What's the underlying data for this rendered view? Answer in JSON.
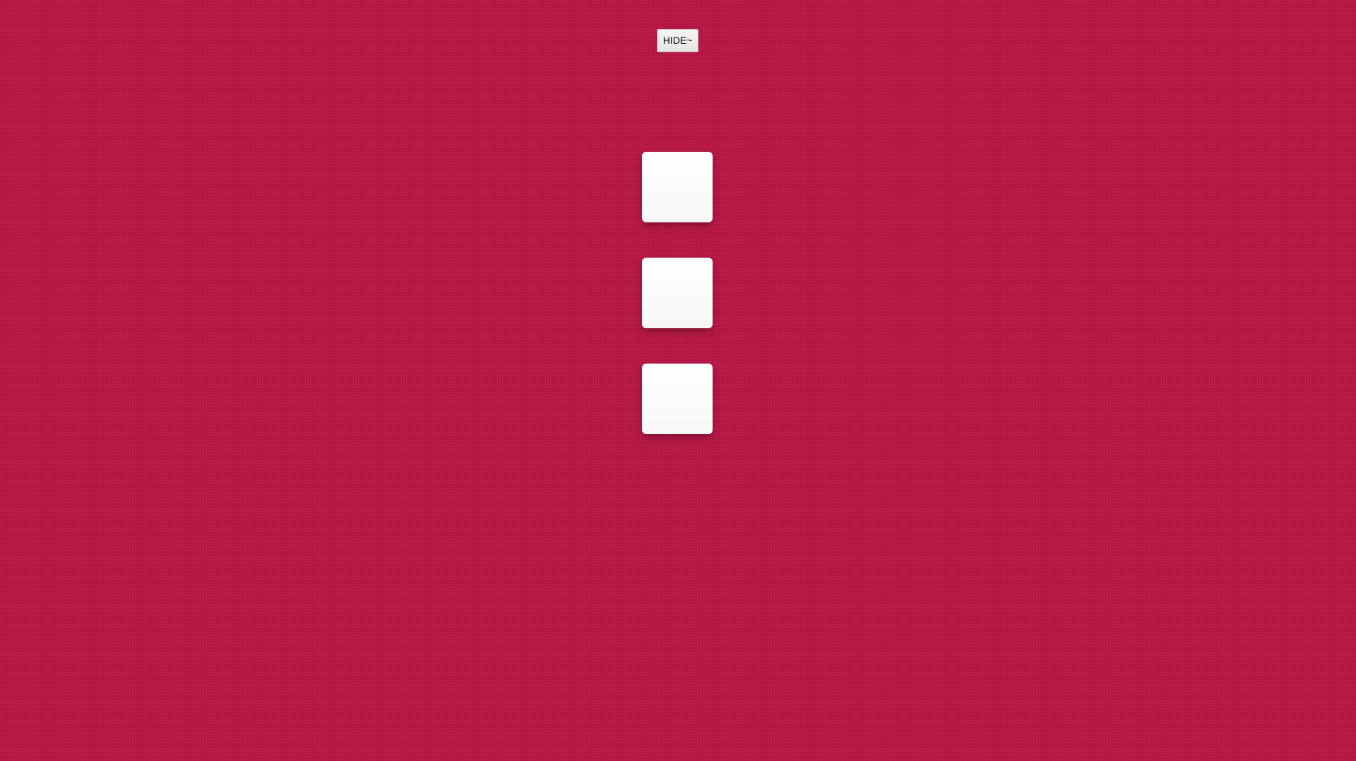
{
  "toolbar": {
    "hide_label": "HIDE~"
  },
  "tiles": [
    {
      "label": ""
    },
    {
      "label": ""
    },
    {
      "label": ""
    }
  ],
  "colors": {
    "background": "#b81846",
    "tile": "#ffffff",
    "button": "#efefef"
  }
}
